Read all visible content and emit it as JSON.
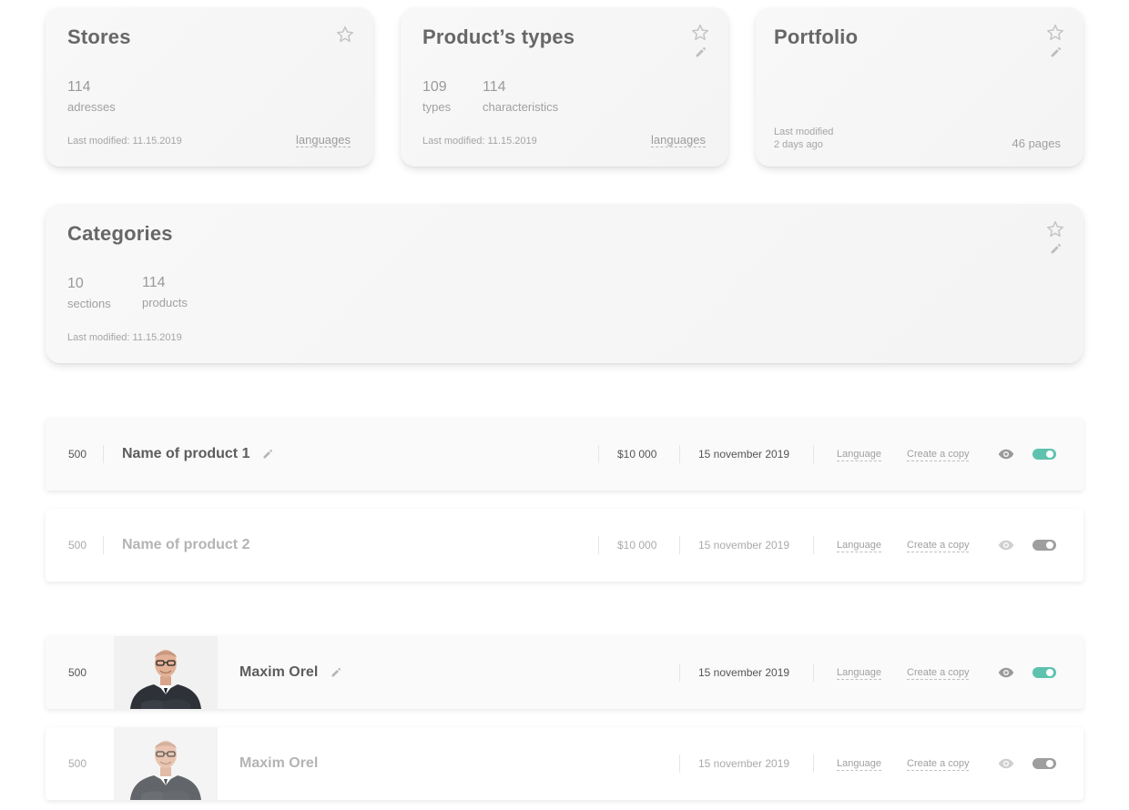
{
  "colors": {
    "toggle_on": "#5ec2ae",
    "toggle_off": "#9e9e9e"
  },
  "cards": {
    "stores": {
      "title": "Stores",
      "stats": [
        {
          "num": "114",
          "label": "adresses"
        }
      ],
      "modified": "Last modified: 11.15.2019",
      "link": "languages"
    },
    "product_types": {
      "title": "Product’s types",
      "stats": [
        {
          "num": "109",
          "label": "types"
        },
        {
          "num": "114",
          "label": "characteristics"
        }
      ],
      "modified": "Last modified: 11.15.2019",
      "link": "languages"
    },
    "portfolio": {
      "title": "Portfolio",
      "modified_line1": "Last modified",
      "modified_line2": "2 days ago",
      "pages": "46 pages"
    },
    "categories": {
      "title": "Categories",
      "stats": [
        {
          "num": "10",
          "label": "sections"
        },
        {
          "num": "114",
          "label": "products"
        }
      ],
      "modified": "Last modified: 11.15.2019"
    }
  },
  "product_rows": [
    {
      "num": "500",
      "name": "Name of product 1",
      "price": "$10 000",
      "date": "15 november 2019",
      "language": "Language",
      "copy": "Create a copy",
      "active": true
    },
    {
      "num": "500",
      "name": "Name of product 2",
      "price": "$10 000",
      "date": "15 november 2019",
      "language": "Language",
      "copy": "Create a copy",
      "active": false
    }
  ],
  "person_rows": [
    {
      "num": "500",
      "name": "Maxim Orel",
      "date": "15 november 2019",
      "language": "Language",
      "copy": "Create a copy",
      "active": true
    },
    {
      "num": "500",
      "name": "Maxim Orel",
      "date": "15 november 2019",
      "language": "Language",
      "copy": "Create a copy",
      "active": false
    }
  ]
}
